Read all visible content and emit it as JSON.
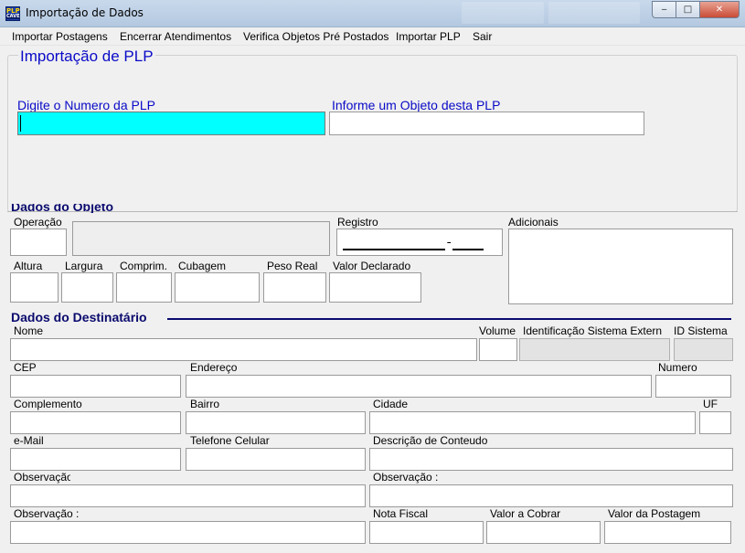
{
  "window": {
    "title": "Importação de Dados",
    "icon_name": "app-logo-icon",
    "icon_text_top": "PLP",
    "icon_text_bottom": "CAVE"
  },
  "menu": [
    {
      "label": "Importar Postagens"
    },
    {
      "label": "Encerrar Atendimentos"
    },
    {
      "label": "Verifica Objetos Pré Postados"
    },
    {
      "label": "Importar PLP"
    },
    {
      "label": "Sair"
    }
  ],
  "plp": {
    "group_title": "Importação de PLP",
    "plp_number_label": "Digite o Numero da PLP",
    "plp_number_value": "",
    "object_label": "Informe um Objeto desta PLP",
    "object_value": ""
  },
  "objeto": {
    "section_title": "Dados do Objeto",
    "operacao_label": "Operação",
    "registro_label": "Registro",
    "registro_mask_left": "_______________",
    "registro_mask_sep": "-",
    "registro_mask_right": "____",
    "adicionais_label": "Adicionais",
    "altura_label": "Altura",
    "largura_label": "Largura",
    "comprim_label": "Comprim.",
    "cubagem_label": "Cubagem",
    "peso_label": "Peso Real",
    "valor_declarado_label": "Valor Declarado"
  },
  "destinatario": {
    "section_title": "Dados do Destinatário",
    "nome_label": "Nome",
    "volume_label": "Volume",
    "id_sistema_externo_label": "Identificação Sistema Extern",
    "id_sistema_label": "ID Sistema",
    "cep_label": "CEP",
    "endereco_label": "Endereço",
    "numero_label": "Numero",
    "complemento_label": "Complemento",
    "bairro_label": "Bairro",
    "cidade_label": "Cidade",
    "uf_label": "UF",
    "email_label": "e-Mail",
    "telefone_label": "Telefone Celular",
    "descricao_label": "Descrição de Conteudo",
    "obs1_label": "Observação",
    "obs2_label": "Observação :",
    "obs3_label": "Observação :",
    "nota_fiscal_label": "Nota Fiscal",
    "valor_cobrar_label": "Valor a Cobrar",
    "valor_postagem_label": "Valor da Postagem"
  }
}
